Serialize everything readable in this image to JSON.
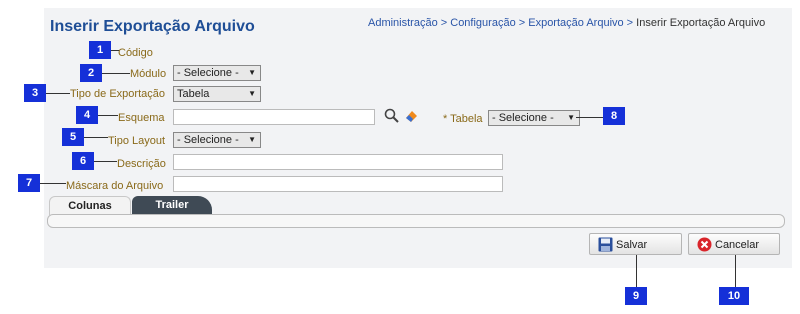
{
  "header": {
    "title": "Inserir Exportação Arquivo",
    "breadcrumb": [
      "Administração",
      "Configuração",
      "Exportação Arquivo",
      "Inserir Exportação Arquivo"
    ],
    "breadcrumb_sep": " > "
  },
  "form": {
    "codigo_label": "Código",
    "modulo_label": "Módulo",
    "modulo_value": "- Selecione -",
    "tipo_exportacao_label": "Tipo de Exportação",
    "tipo_exportacao_value": "Tabela",
    "esquema_label": "Esquema",
    "esquema_value": "",
    "tabela_label": "* Tabela",
    "tabela_value": "- Selecione -",
    "tipo_layout_label": "Tipo Layout",
    "tipo_layout_value": "- Selecione -",
    "descricao_label": "Descrição",
    "descricao_value": "",
    "mascara_label": "Máscara do Arquivo",
    "mascara_value": ""
  },
  "tabs": [
    {
      "label": "Colunas",
      "active": true
    },
    {
      "label": "Trailer",
      "active": false
    }
  ],
  "buttons": {
    "save": "Salvar",
    "cancel": "Cancelar"
  },
  "callouts": [
    "1",
    "2",
    "3",
    "4",
    "5",
    "6",
    "7",
    "8",
    "9",
    "10"
  ],
  "colors": {
    "title": "#1f4e96",
    "label": "#8a6a1a",
    "callout": "#1530d8",
    "tab_inactive": "#3f4a55"
  }
}
